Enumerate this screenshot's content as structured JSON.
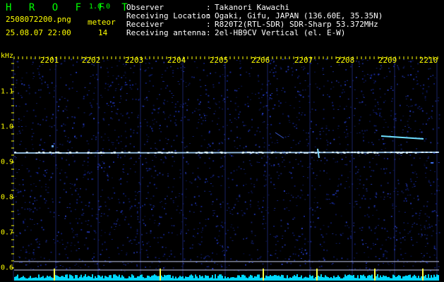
{
  "app": {
    "brand": "H R O F F T",
    "version": "1.0.0"
  },
  "file": {
    "name": "2508072200.png",
    "datetime": "25.08.07 22:00"
  },
  "meteor": {
    "label": "meteor",
    "count": "14"
  },
  "station": [
    {
      "key": "Observer",
      "sep": ":",
      "value": "Takanori Kawachi"
    },
    {
      "key": "Receiving Location",
      "sep": ":",
      "value": "Ogaki, Gifu, JAPAN (136.60E, 35.35N)"
    },
    {
      "key": "Receiver",
      "sep": ":",
      "value": "R820T2(RTL-SDR) SDR-Sharp 53.372MHz"
    },
    {
      "key": "Receiving antenna",
      "sep": ":",
      "value": "2el-HB9CV Vertical (el. E-W)"
    }
  ],
  "axes": {
    "freq_unit": "kHz",
    "time_ticks": [
      "2201",
      "2202",
      "2203",
      "2204",
      "2205",
      "2206",
      "2207",
      "2208",
      "2209",
      "2210"
    ],
    "freq_ticks": [
      "1.1",
      "1.0",
      "0.9",
      "0.8",
      "0.7",
      "0.6"
    ]
  },
  "colors": {
    "background": "#000000",
    "noise_blue": "#1a2fa0",
    "carrier": "#a8d8ff",
    "header_label": "#ffff00",
    "brand_green": "#00ff00",
    "amplitude": "#00d8ff"
  }
}
